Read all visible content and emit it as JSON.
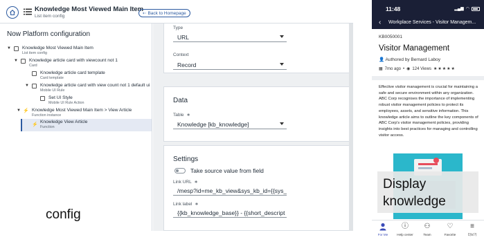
{
  "config_app": {
    "title": "Knowledge Most Viewed Main Item",
    "subtitle": "List item config",
    "back_label": "Back to Homepage",
    "tree_heading": "Now Platform configuration",
    "tree": [
      {
        "label": "Knowledge Most Viewed Main Item",
        "sub": "List item config"
      },
      {
        "label": "Knowledge article card with viewcount not 1",
        "sub": "Card"
      },
      {
        "label": "Knowledge article card template",
        "sub": "Card template"
      },
      {
        "label": "Knowledge article card with view count not 1 default ui",
        "sub": "Mobile UI Rule"
      },
      {
        "label": "Set UI Style",
        "sub": "Mobile UI Rule Action"
      },
      {
        "label": "Knowledge Most Viewed Main Item > View Article",
        "sub": "Function instance"
      },
      {
        "label": "Knowledge View Article",
        "sub": "Function"
      }
    ],
    "annotation": "config",
    "form": {
      "type_label": "Type",
      "type_value": "URL",
      "context_label": "Context",
      "context_value": "Record",
      "data_title": "Data",
      "table_label": "Table",
      "table_value": "Knowledge [kb_knowledge]",
      "settings_title": "Settings",
      "toggle_label": "Take source value from field",
      "link_url_label": "Link URL",
      "link_url_value": "/mesp?id=me_kb_view&sys_kb_id={{sys_i",
      "link_label_label": "Link label",
      "link_label_value": "{{kb_knowledge_base}} - {{short_descript",
      "required_mark": "∗"
    }
  },
  "phone": {
    "time": "11:48",
    "nav_title": "Workplace Services - Visitor Managem...",
    "kb_number": "KB0050001",
    "article_title": "Visitor Management",
    "author": "Authored by Bernard Laboy",
    "age": "7mo ago",
    "views": "124 Views",
    "rating": "★★★★★",
    "body": "Effective visitor management is crucial for maintaining a safe and secure environment within any organization. ABC Corp recognises the importance of implementing robust visitor management policies to protect its employees, assets, and sensitive information. This knowledge article aims to outline the key components of ABC Corp's visitor management policies, providing insights into best practices for managing and controlling visitor access.",
    "annotation_line1": "Display",
    "annotation_line2": "knowledge",
    "tabs": [
      {
        "label": "For Me",
        "icon": "person-icon"
      },
      {
        "label": "Help center",
        "icon": "question-icon"
      },
      {
        "label": "Team",
        "icon": "team-icon"
      },
      {
        "label": "Favorite",
        "icon": "heart-icon"
      },
      {
        "label": "더보기",
        "icon": "menu-icon"
      }
    ],
    "accent_color": "#3b4cb8",
    "header_color": "#1a1f36"
  }
}
